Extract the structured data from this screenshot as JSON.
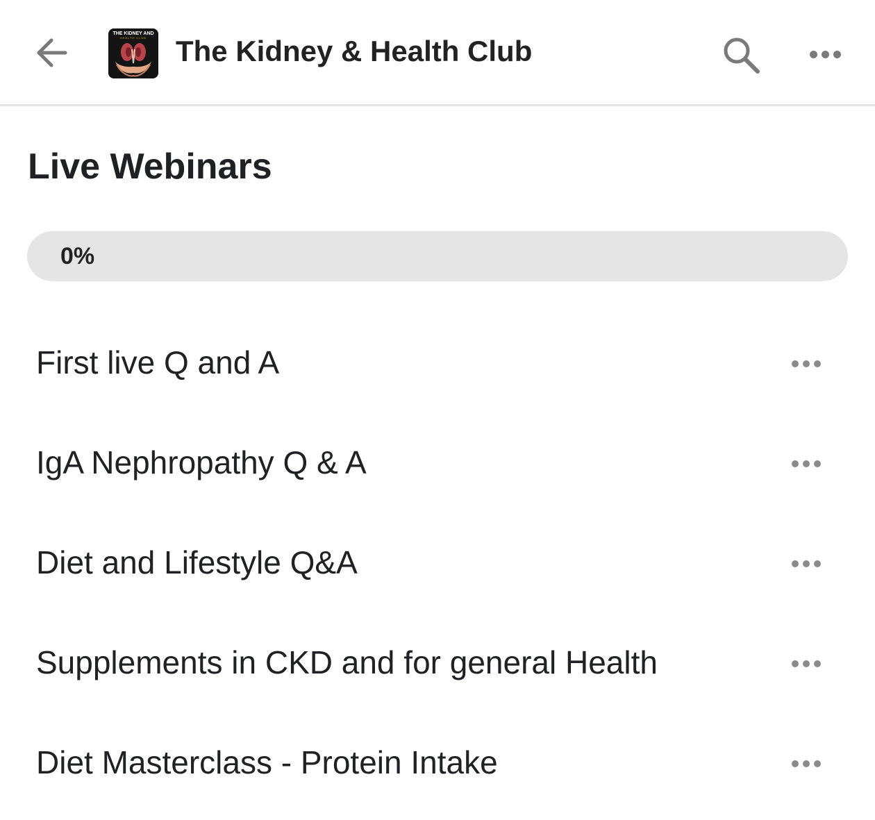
{
  "header": {
    "back_icon": "arrow-left-icon",
    "logo_text_top": "THE KIDNEY AND",
    "logo_text_bottom": "HEALTH CLUB",
    "title": "The Kidney & Health Club",
    "search_icon": "search-icon",
    "more_icon": "more-horizontal-icon"
  },
  "section": {
    "title": "Live Webinars"
  },
  "progress": {
    "label": "0%",
    "value": 0
  },
  "lessons": [
    {
      "label": "First live Q and A"
    },
    {
      "label": "IgA Nephropathy Q & A"
    },
    {
      "label": "Diet and Lifestyle Q&A"
    },
    {
      "label": "Supplements in CKD and for general Health"
    },
    {
      "label": "Diet Masterclass - Protein Intake"
    }
  ],
  "colors": {
    "progress_track": "#e5e5e5",
    "divider": "#e4e4e4",
    "icon_gray": "#7a7a7a"
  }
}
